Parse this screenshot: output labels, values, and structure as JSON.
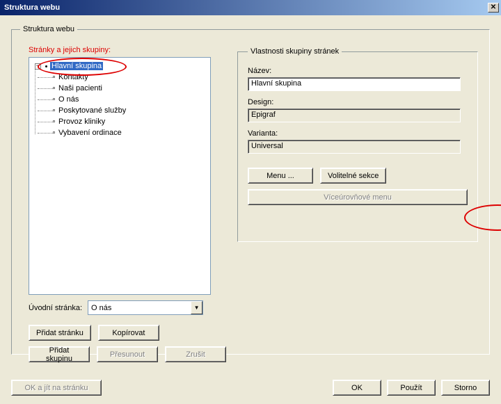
{
  "window": {
    "title": "Struktura webu",
    "close_glyph": "✕"
  },
  "groupbox": {
    "main_legend": "Struktura webu",
    "props_legend": "Vlastnosti skupiny stránek"
  },
  "tree": {
    "label": "Stránky a jejich skupiny:",
    "toggle_glyph": "−",
    "root": "Hlavní skupina",
    "items": [
      "Kontakty",
      "Naši pacienti",
      "O nás",
      "Poskytované služby",
      "Provoz kliniky",
      "Vybavení ordinace"
    ]
  },
  "intro": {
    "label": "Úvodní stránka:",
    "value": "O nás",
    "arrow": "▼"
  },
  "buttons": {
    "add_page": "Přidat stránku",
    "copy": "Kopírovat",
    "add_group": "Přidat skupinu",
    "move": "Přesunout",
    "cancel": "Zrušit",
    "menu": "Menu ...",
    "optional_sections": "Volitelné sekce",
    "multilevel_menu": "Víceúrovňové menu",
    "ok_goto": "OK a jít na stránku",
    "ok": "OK",
    "apply": "Použít",
    "storno": "Storno"
  },
  "props": {
    "name_label": "Název:",
    "name_value": "Hlavní skupina",
    "design_label": "Design:",
    "design_value": "Epigraf",
    "variant_label": "Varianta:",
    "variant_value": "Universal"
  }
}
